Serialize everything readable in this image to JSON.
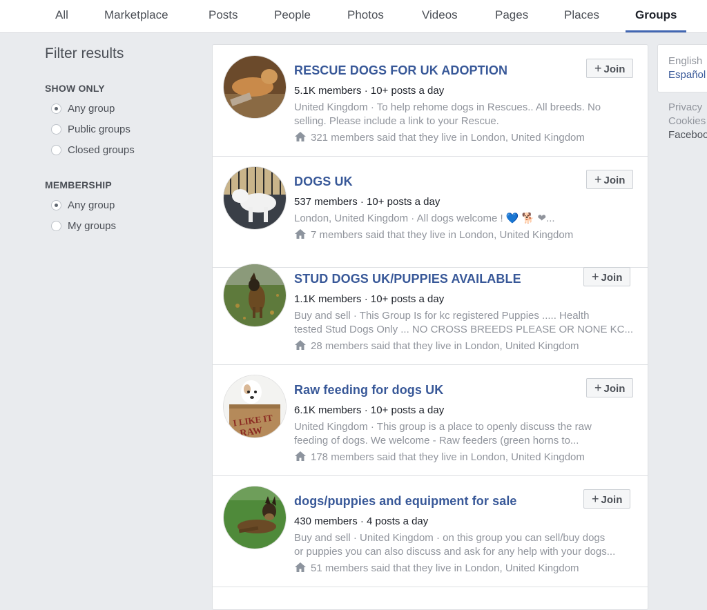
{
  "tabs": [
    {
      "label": "All",
      "active": false
    },
    {
      "label": "Marketplace",
      "active": false
    },
    {
      "label": "Posts",
      "active": false
    },
    {
      "label": "People",
      "active": false
    },
    {
      "label": "Photos",
      "active": false
    },
    {
      "label": "Videos",
      "active": false
    },
    {
      "label": "Pages",
      "active": false
    },
    {
      "label": "Places",
      "active": false
    },
    {
      "label": "Groups",
      "active": true
    }
  ],
  "filters": {
    "title": "Filter results",
    "show_only": {
      "heading": "SHOW ONLY",
      "options": [
        {
          "label": "Any group",
          "checked": true
        },
        {
          "label": "Public groups",
          "checked": false
        },
        {
          "label": "Closed groups",
          "checked": false
        }
      ]
    },
    "membership": {
      "heading": "MEMBERSHIP",
      "options": [
        {
          "label": "Any group",
          "checked": true
        },
        {
          "label": "My groups",
          "checked": false
        }
      ]
    }
  },
  "results": [
    {
      "name": "RESCUE DOGS FOR UK ADOPTION",
      "stats": "5.1K members · 10+ posts a day",
      "desc_line1": "United Kingdom · To help rehome dogs in Rescues.. All breeds. No",
      "desc_line2": "selling. Please include a link to your Rescue.",
      "location": "321 members said that they live in London, United Kingdom",
      "join_label": "Join"
    },
    {
      "name": "DOGS UK",
      "stats": "537 members · 10+ posts a day",
      "desc_line1": "London, United Kingdom · All dogs welcome ! 💙 🐕 ❤...",
      "desc_line2": "",
      "location": "7 members said that they live in London, United Kingdom",
      "join_label": "Join"
    },
    {
      "name": "STUD DOGS UK/PUPPIES AVAILABLE",
      "stats": "1.1K members · 10+ posts a day",
      "desc_line1": "Buy and sell · This Group Is for kc registered Puppies ..... Health",
      "desc_line2": "tested Stud Dogs Only ... NO CROSS BREEDS PLEASE OR NONE KC...",
      "location": "28 members said that they live in London, United Kingdom",
      "join_label": "Join"
    },
    {
      "name": "Raw feeding for dogs UK",
      "stats": "6.1K members · 10+ posts a day",
      "desc_line1": "United Kingdom · This group is a place to openly discuss the raw",
      "desc_line2": "feeding of dogs. We welcome - Raw feeders (green horns to...",
      "location": "178 members said that they live in London, United Kingdom",
      "join_label": "Join"
    },
    {
      "name": "dogs/puppies and equipment for sale",
      "stats": "430 members · 4 posts a day",
      "desc_line1": "Buy and sell · United Kingdom · on this group you can sell/buy dogs",
      "desc_line2": "or puppies you can also discuss and ask for any help with your dogs...",
      "location": "51 members said that they live in London, United Kingdom",
      "join_label": "Join"
    }
  ],
  "sidebar": {
    "language_current": "English",
    "language_link": "Español",
    "links": [
      "Privacy",
      "Cookies",
      "Facebook"
    ]
  },
  "colors": {
    "link_blue": "#385898",
    "tab_underline": "#4267b2",
    "page_bg": "#e9ebee"
  }
}
